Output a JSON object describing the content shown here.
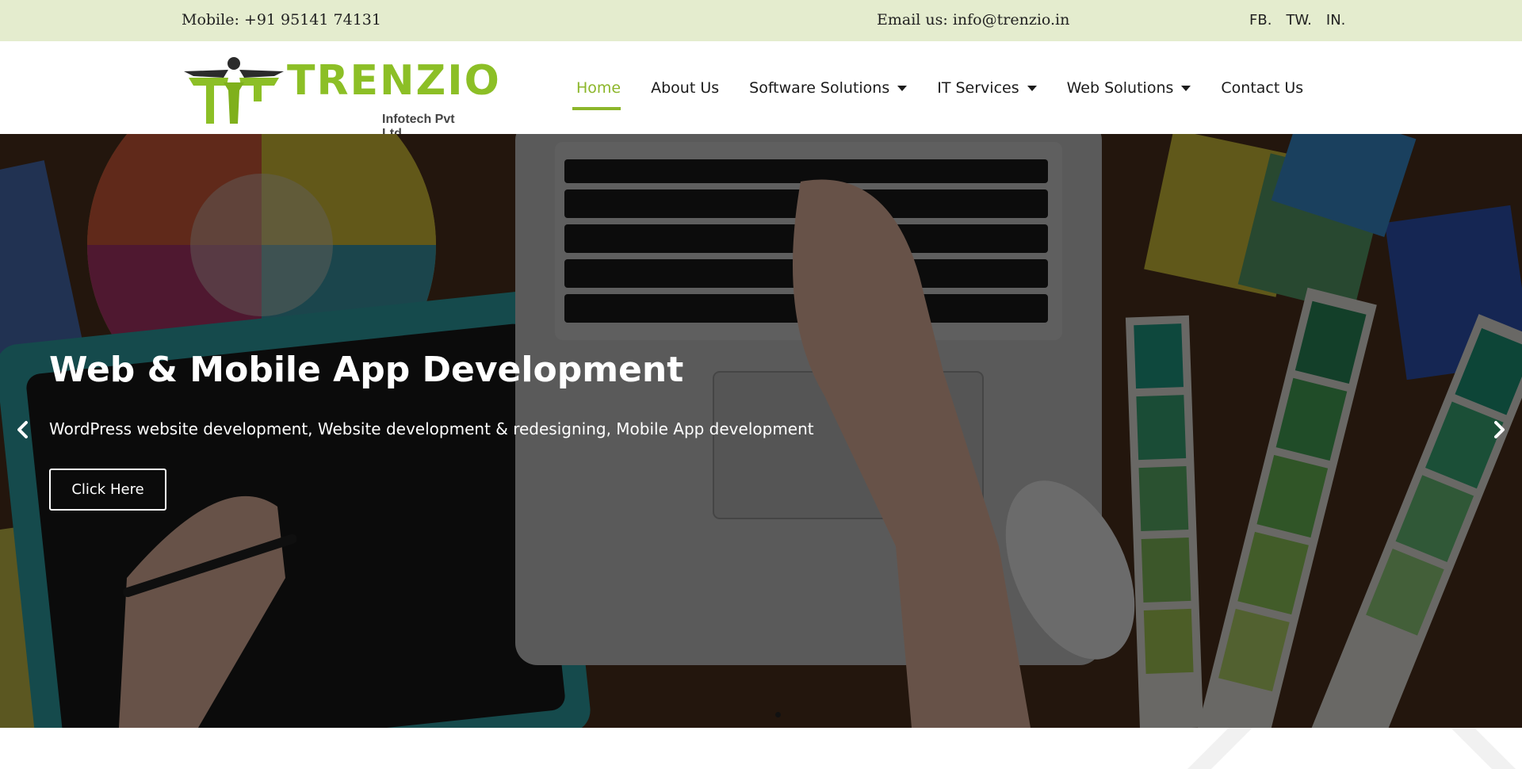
{
  "topbar": {
    "mobile": "Mobile: +91 95141 74131",
    "email": "Email us: info@trenzio.in",
    "social": [
      "FB.",
      "TW.",
      "IN."
    ]
  },
  "brand": {
    "name": "TRENZIO",
    "tagline": "Infotech Pvt Ltd",
    "color": "#8cbf26"
  },
  "nav": {
    "items": [
      {
        "label": "Home",
        "active": true,
        "dropdown": false
      },
      {
        "label": "About Us",
        "active": false,
        "dropdown": false
      },
      {
        "label": "Software Solutions",
        "active": false,
        "dropdown": true
      },
      {
        "label": "IT Services",
        "active": false,
        "dropdown": true
      },
      {
        "label": "Web Solutions",
        "active": false,
        "dropdown": true
      },
      {
        "label": "Contact Us",
        "active": false,
        "dropdown": false
      }
    ],
    "active_color": "#8cb62a"
  },
  "hero": {
    "title": "Web & Mobile App Development",
    "subtitle": "WordPress website development, Website development & redesigning, Mobile App development",
    "button": "Click Here",
    "prev_icon": "chevron-left-icon",
    "next_icon": "chevron-right-icon",
    "slide_count": 2,
    "active_slide": 1
  }
}
